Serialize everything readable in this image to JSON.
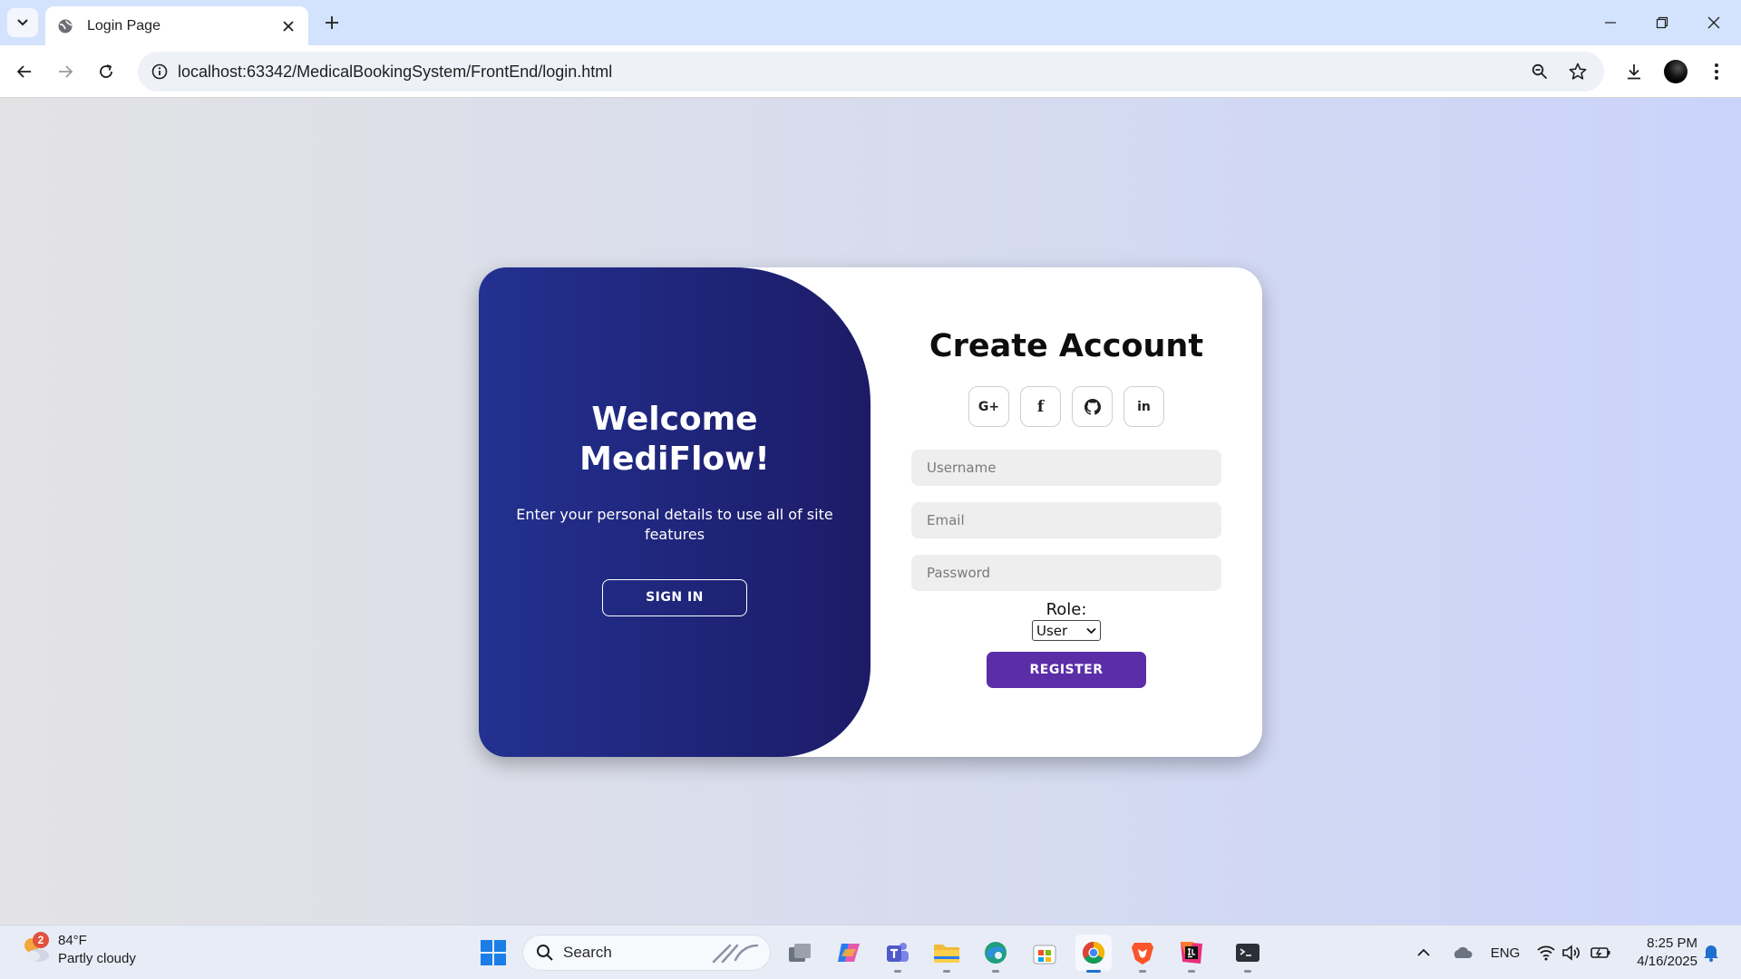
{
  "browser": {
    "tab_title": "Login Page",
    "url": "localhost:63342/MedicalBookingSystem/FrontEnd/login.html"
  },
  "welcome": {
    "title": "Welcome MediFlow!",
    "message": "Enter your personal details to use all of site features",
    "signin_label": "SIGN IN"
  },
  "form": {
    "title": "Create Account",
    "socials": [
      {
        "icon": "google-plus-icon",
        "text": "G+"
      },
      {
        "icon": "facebook-icon",
        "text": "f"
      },
      {
        "icon": "github-icon"
      },
      {
        "icon": "linkedin-icon",
        "text": "in"
      }
    ],
    "username_placeholder": "Username",
    "email_placeholder": "Email",
    "password_placeholder": "Password",
    "role_label": "Role:",
    "role_selected": "User",
    "register_label": "REGISTER"
  },
  "taskbar": {
    "weather_temp": "84°F",
    "weather_desc": "Partly cloudy",
    "weather_badge": "2",
    "search_label": "Search",
    "language": "ENG",
    "time": "8:25 PM",
    "date": "4/16/2025"
  },
  "colors": {
    "welcome_panel": "#1e2370",
    "register_button": "#5b2ea8",
    "tabstrip": "#d3e3fd"
  }
}
